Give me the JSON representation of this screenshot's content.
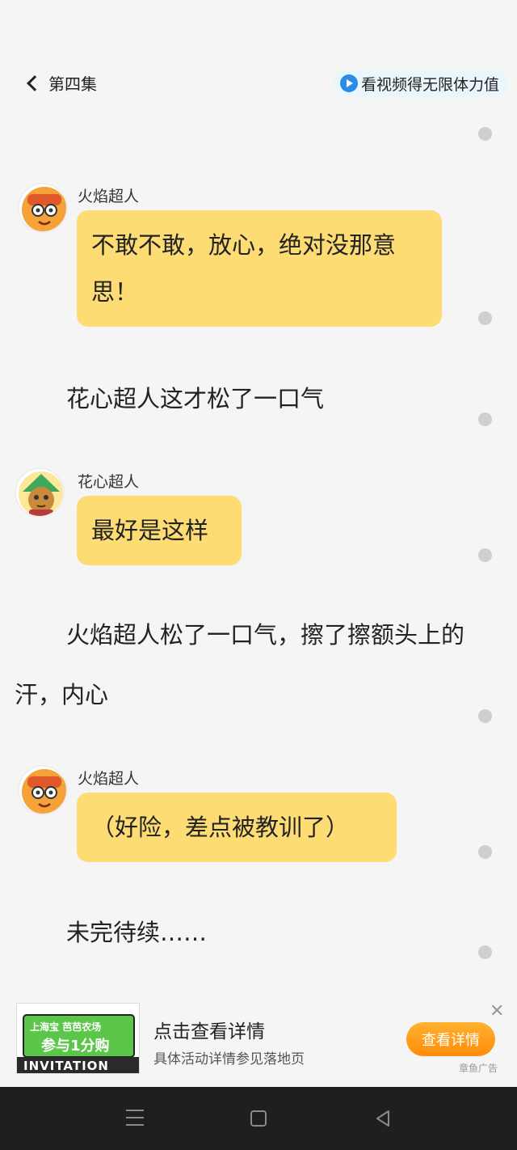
{
  "header": {
    "back_title": "第四集",
    "promo_label": "看视频得无限体力值"
  },
  "chat": {
    "msg1": {
      "speaker": "火焰超人",
      "text": "不敢不敢，放心，绝对没那意思！"
    },
    "narration1": "花心超人这才松了一口气",
    "msg2": {
      "speaker": "花心超人",
      "text": "最好是这样"
    },
    "narration2": "火焰超人松了一口气，擦了擦额头上的汗，内心",
    "msg3": {
      "speaker": "火焰超人",
      "text": "（好险，差点被教训了）"
    },
    "narration3": "未完待续……"
  },
  "ad": {
    "image_text_top": "上海宝  芭芭农场",
    "image_text_main": "参与1分购",
    "image_text_bottom": "INVITATION",
    "title": "点击查看详情",
    "subtitle": "具体活动详情参见落地页",
    "button": "查看详情",
    "tag": "章鱼广告"
  },
  "colors": {
    "bubble": "#fddc74",
    "accent": "#ff8c0a",
    "play_icon": "#2a8be8"
  }
}
